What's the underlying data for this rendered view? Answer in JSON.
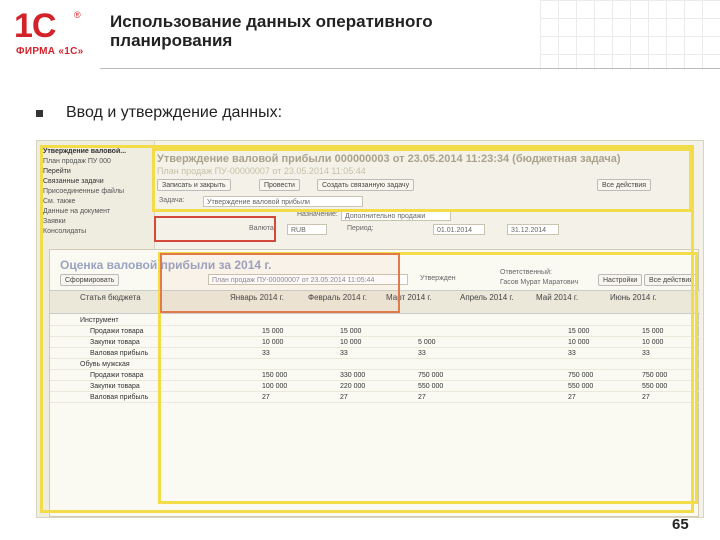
{
  "header": {
    "logo_mark": "1С",
    "logo_reg": "®",
    "logo_text": "ФИРМА «1С»",
    "title": "Использование данных оперативного планирования"
  },
  "bullet": "Ввод и утверждение данных:",
  "page_number": "65",
  "screenshot": {
    "left_nav": [
      "Утверждение валовой...",
      "План продаж ПУ 000",
      "Перейти",
      "Связанные задачи",
      "Присоединенные файлы",
      "См. также",
      "Данные на документ",
      "Заявки",
      "Консолидаты"
    ],
    "back_title": "Утверждение валовой прибыли 000000003 от 23.05.2014 11:23:34 (бюджетная задача)",
    "back_subtitle": "План продаж ПУ-00000007 от 23.05.2014 11:05:44",
    "back_toolbar": [
      "Записать и закрыть",
      "Провести",
      "Создать связанную задачу",
      "Все действия"
    ],
    "back_fields": {
      "task_label": "Задача:",
      "task_value": "Утверждение валовой прибыли",
      "purpose_label": "Назначение:",
      "purpose_value": "Дополнительно продажи",
      "currency_label": "Валюта:",
      "currency_value": "RUB",
      "period_label": "Период:",
      "period_from": "01.01.2014",
      "period_to": "31.12.2014",
      "status_value": "Утвержден",
      "responsible_label": "Ответственный:",
      "responsible_value": "Гасов Мурат Маратович"
    },
    "front_title": "Оценка валовой прибыли за 2014 г.",
    "front_toolbar": [
      "Сформировать",
      "Настройки",
      "Все действия"
    ],
    "columns": [
      "Статья бюджета",
      "Январь 2014 г.",
      "Февраль 2014 г.",
      "Март 2014 г.",
      "Апрель 2014 г.",
      "Май 2014 г.",
      "Июнь 2014 г."
    ],
    "rows": [
      {
        "label": "Инструмент",
        "vals": [
          "",
          "",
          "",
          "",
          "",
          ""
        ]
      },
      {
        "label": "Продажи товара",
        "vals": [
          "15 000",
          "15 000",
          "",
          "",
          "15 000",
          "15 000"
        ]
      },
      {
        "label": "Закупки товара",
        "vals": [
          "10 000",
          "10 000",
          "5 000",
          "",
          "10 000",
          "10 000"
        ]
      },
      {
        "label": "Валовая прибыль",
        "vals": [
          "33",
          "33",
          "33",
          "",
          "33",
          "33"
        ]
      },
      {
        "label": "Обувь мужская",
        "vals": [
          "",
          "",
          "",
          "",
          "",
          ""
        ]
      },
      {
        "label": "Продажи товара",
        "vals": [
          "150 000",
          "330 000",
          "750 000",
          "",
          "750 000",
          "750 000"
        ]
      },
      {
        "label": "Закупки товара",
        "vals": [
          "100 000",
          "220 000",
          "550 000",
          "",
          "550 000",
          "550 000"
        ]
      },
      {
        "label": "Валовая прибыль",
        "vals": [
          "27",
          "27",
          "27",
          "",
          "27",
          "27"
        ]
      }
    ]
  }
}
